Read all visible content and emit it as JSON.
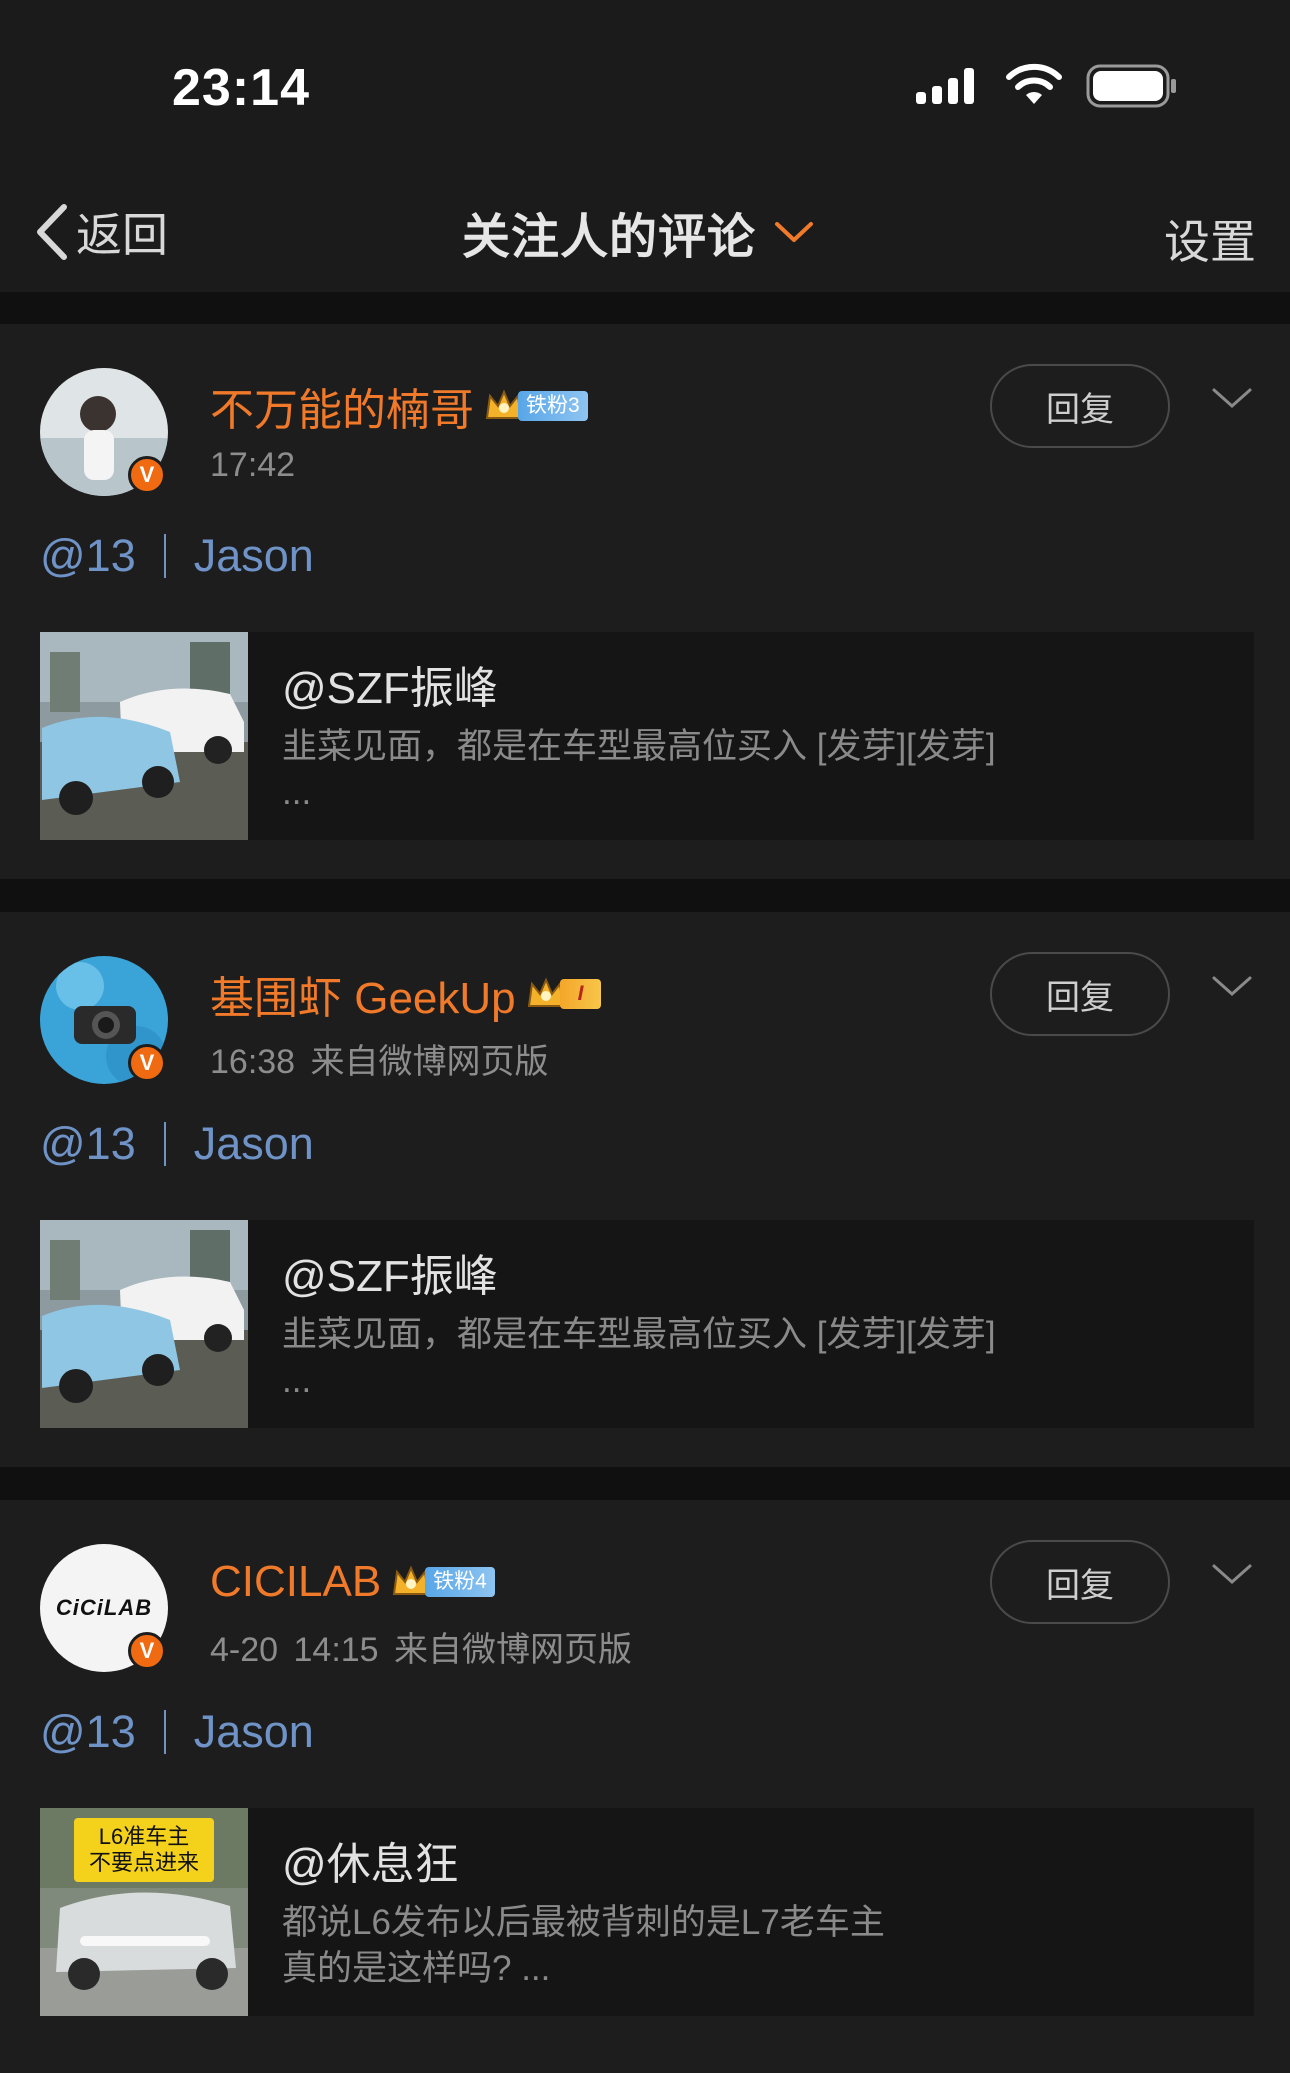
{
  "status_bar": {
    "time": "23:14",
    "battery_icon": "battery-full-icon",
    "wifi_icon": "wifi-icon",
    "signal_icon": "cellular-signal-icon"
  },
  "nav": {
    "back_label": "返回",
    "title": "关注人的评论",
    "settings_label": "设置",
    "accent_color": "#f07a2a"
  },
  "comments": [
    {
      "username": "不万能的楠哥",
      "badge_label": "铁粉3",
      "time": "17:42",
      "source": "",
      "reply_label": "回复",
      "comment_prefix": "@13",
      "comment_text": "Jason",
      "quote": {
        "author": "@SZF振峰",
        "text": "韭菜见面，都是在车型最高位买入 [发芽][发芽]\n..."
      }
    },
    {
      "username": "基围虾 GeekUp",
      "badge_label": "I",
      "time": "16:38",
      "source": "来自微博网页版",
      "reply_label": "回复",
      "comment_prefix": "@13",
      "comment_text": "Jason",
      "quote": {
        "author": "@SZF振峰",
        "text": "韭菜见面，都是在车型最高位买入 [发芽][发芽]\n..."
      }
    },
    {
      "username": "CICILAB",
      "badge_label": "铁粉4",
      "avatar_text": "CiCiLAB",
      "time": "4-20 14:15",
      "source": "来自微博网页版",
      "reply_label": "回复",
      "comment_prefix": "@13",
      "comment_text": "Jason",
      "quote": {
        "author": "@休息狂",
        "text": "都说L6发布以后最被背刺的是L7老车主\n真的是这样吗? ...",
        "thumb_caption_1": "L6准车主",
        "thumb_caption_2": "不要点进来"
      }
    }
  ]
}
